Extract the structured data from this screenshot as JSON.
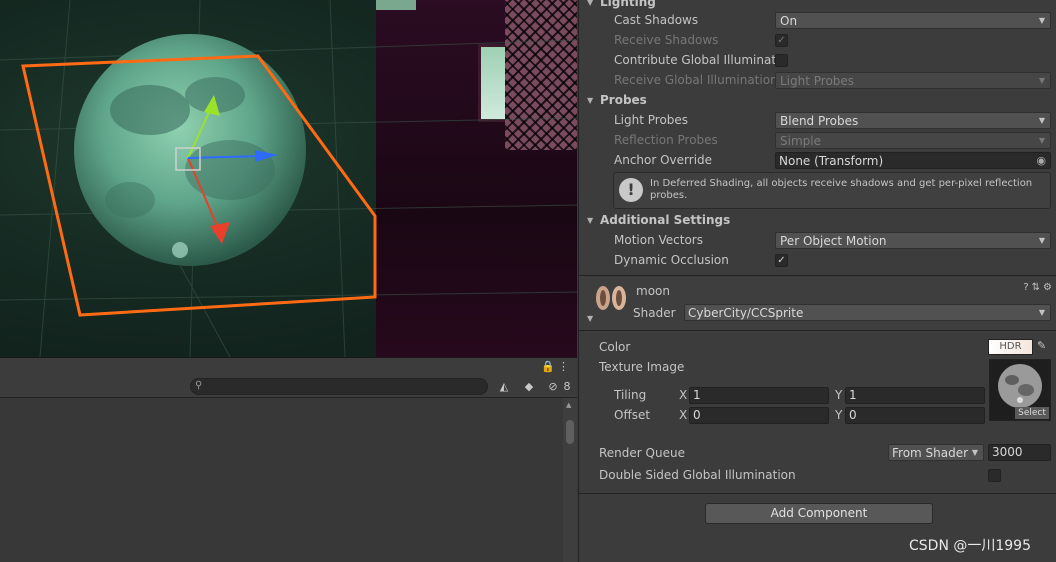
{
  "colors": {
    "selection_outline": "#ff6a14",
    "gizmo_y": "#9be22a",
    "gizmo_x": "#e8402a",
    "gizmo_z": "#2f6bff",
    "inspector_bg": "#3c3c3c"
  },
  "scene": {
    "gizmo_icons": [
      "move-gizmo-y-arrow",
      "move-gizmo-x-arrow",
      "move-gizmo-z-arrow",
      "move-gizmo-center-square"
    ]
  },
  "lower_panel": {
    "lock_icon": "🔒",
    "menu_icon": "⋮",
    "search": {
      "placeholder": "",
      "value": ""
    },
    "visibility_count": "8"
  },
  "inspector": {
    "lighting": {
      "title": "Lighting",
      "cast_shadows": {
        "label": "Cast Shadows",
        "value": "On"
      },
      "receive_shadows": {
        "label": "Receive Shadows",
        "checked": "✓"
      },
      "contribute_gi": {
        "label": "Contribute Global Illuminatio"
      },
      "receive_gi": {
        "label": "Receive Global Illumination",
        "value": "Light Probes"
      }
    },
    "probes": {
      "title": "Probes",
      "light_probes": {
        "label": "Light Probes",
        "value": "Blend Probes"
      },
      "reflection_probes": {
        "label": "Reflection Probes",
        "value": "Simple"
      },
      "anchor_override": {
        "label": "Anchor Override",
        "value": "None (Transform)"
      },
      "help_message": "In Deferred Shading, all objects receive shadows and get per-pixel reflection probes."
    },
    "additional": {
      "title": "Additional Settings",
      "motion_vectors": {
        "label": "Motion Vectors",
        "value": "Per Object Motion"
      },
      "dynamic_occlusion": {
        "label": "Dynamic Occlusion",
        "checked": "✓"
      }
    },
    "material": {
      "name": "moon",
      "shader_label": "Shader",
      "shader_value": "CyberCity/CCSprite",
      "color_label": "Color",
      "hdr_label": "HDR",
      "texture_label": "Texture Image",
      "tiling_label": "Tiling",
      "offset_label": "Offset",
      "x_axis": "X",
      "y_axis": "Y",
      "tiling_x": "1",
      "tiling_y": "1",
      "offset_x": "0",
      "offset_y": "0",
      "texture_select": "Select",
      "render_queue_label": "Render Queue",
      "render_queue_mode": "From Shader",
      "render_queue_value": "3000",
      "double_sided_gi_label": "Double Sided Global Illumination"
    },
    "add_component": "Add Component"
  },
  "watermark": "CSDN @一川1995"
}
